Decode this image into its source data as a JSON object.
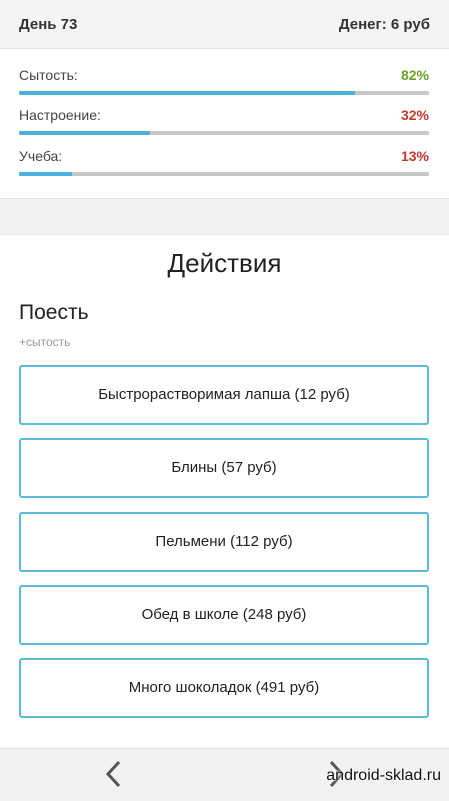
{
  "header": {
    "day": "День 73",
    "money": "Денег: 6 руб"
  },
  "stats": [
    {
      "label": "Сытость:",
      "value": "82%",
      "fraction": 0.82,
      "color": "#6aa32a"
    },
    {
      "label": "Настроение:",
      "value": "32%",
      "fraction": 0.32,
      "color": "#c0392b"
    },
    {
      "label": "Учеба:",
      "value": "13%",
      "fraction": 0.13,
      "color": "#c0392b"
    }
  ],
  "actions": {
    "title": "Действия",
    "section": "Поесть",
    "section_hint": "+сытость",
    "buttons": [
      "Быстрорастворимая лапша (12 руб)",
      "Блины (57 руб)",
      "Пельмени (112 руб)",
      "Обед в школе (248 руб)",
      "Много шоколадок (491 руб)"
    ]
  },
  "footer": {
    "watermark": "android-sklad.ru"
  },
  "colors": {
    "accent": "#4ab0dd",
    "button_border": "#5bbcd9"
  }
}
